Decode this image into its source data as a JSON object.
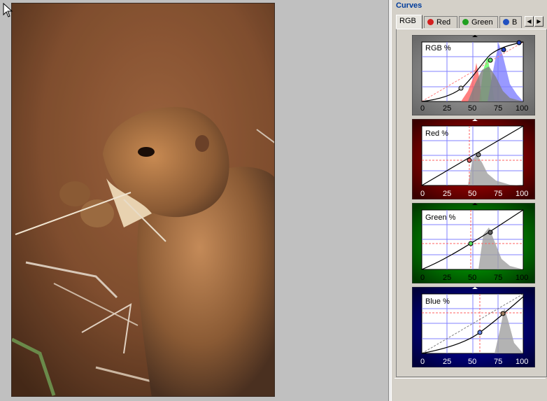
{
  "panel": {
    "title": "Curves"
  },
  "tabs": [
    {
      "label": "RGB",
      "active": true
    },
    {
      "label": "Red",
      "color": "#d42020"
    },
    {
      "label": "Green",
      "color": "#20a020"
    },
    {
      "label": "B",
      "color": "#2050c0"
    }
  ],
  "curves": [
    {
      "id": "rgb",
      "label": "RGB %",
      "bg": "#9a9a9a",
      "bgEdge": "#6a6a6a",
      "border": "#ffffff",
      "tickColor": "#000000",
      "pointColor": "#c8c8c8"
    },
    {
      "id": "red",
      "label": "Red %",
      "bg": "#cc0000",
      "bgEdge": "#3a0000",
      "border": "#ffffff",
      "tickColor": "#ffffff",
      "pointColor": "#e06060"
    },
    {
      "id": "green",
      "label": "Green %",
      "bg": "#00cc00",
      "bgEdge": "#003a00",
      "border": "#ffffff",
      "tickColor": "#000000",
      "pointColor": "#60e060"
    },
    {
      "id": "blue",
      "label": "Blue %",
      "bg": "#0000cc",
      "bgEdge": "#00003a",
      "border": "#ffffff",
      "tickColor": "#ffffff",
      "pointColor": "#6080e0"
    }
  ],
  "axis": {
    "ticks": [
      "0",
      "25",
      "50",
      "75",
      "100"
    ]
  }
}
